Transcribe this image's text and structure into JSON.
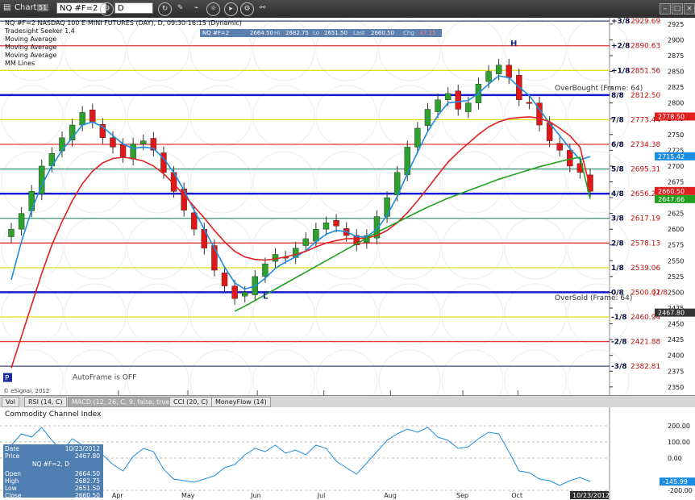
{
  "toolbar": {
    "title": "Chart",
    "badge": "51",
    "symbol": "NQ #F=2",
    "interval": "D"
  },
  "header": {
    "line1": "NQ #F=2 NASDAQ 100 E-MINI FUTURES (DAY), D, 09:30-16:15 (Dynamic)",
    "studies": [
      "Tradesight Seeker 1.4",
      "Moving Average",
      "Moving Average",
      "Moving Average",
      "MM Lines"
    ],
    "quote": {
      "symbol": "NQ #F=2",
      "open": "2664.50",
      "high_label": "Hi",
      "high": "2682.75",
      "low_label": "Lo",
      "low": "2651.50",
      "last_label": "Last",
      "last": "2660.50",
      "chg_label": "Chg",
      "chg": "-37.25"
    }
  },
  "chart_data": [
    {
      "type": "line",
      "title": "NQ #F=2 NASDAQ 100 E-MINI FUTURES (DAY), D, 09:30-16:15 (Dynamic)",
      "x_tick_labels": [
        "Apr",
        "May",
        "Jun",
        "Jul",
        "Aug",
        "Sep",
        "Oct"
      ],
      "y_ticks": [
        2350,
        2375,
        2400,
        2425,
        2450,
        2475,
        2500,
        2525,
        2550,
        2575,
        2600,
        2625,
        2650,
        2675,
        2700,
        2725,
        2750,
        2775,
        2800,
        2825,
        2850,
        2875,
        2900,
        2925
      ],
      "ylim": [
        2337,
        2935
      ],
      "price_series": {
        "name": "NQ #F=2",
        "close": [
          2600,
          2625,
          2660,
          2700,
          2720,
          2745,
          2765,
          2785,
          2770,
          2745,
          2730,
          2715,
          2735,
          2740,
          2725,
          2690,
          2660,
          2630,
          2600,
          2570,
          2535,
          2510,
          2490,
          2500,
          2525,
          2545,
          2560,
          2555,
          2570,
          2585,
          2600,
          2610,
          2605,
          2590,
          2575,
          2590,
          2620,
          2650,
          2690,
          2730,
          2760,
          2790,
          2805,
          2815,
          2790,
          2800,
          2830,
          2850,
          2860,
          2840,
          2805,
          2800,
          2765,
          2740,
          2725,
          2700,
          2690,
          2660
        ]
      },
      "moving_averages": [
        {
          "color": "#1c8ce0",
          "values": [
            2520,
            2580,
            2630,
            2670,
            2700,
            2725,
            2745,
            2765,
            2770,
            2762,
            2748,
            2735,
            2728,
            2730,
            2728,
            2712,
            2690,
            2662,
            2630,
            2600,
            2570,
            2540,
            2515,
            2505,
            2510,
            2522,
            2538,
            2548,
            2556,
            2566,
            2580,
            2592,
            2598,
            2596,
            2588,
            2588,
            2600,
            2622,
            2652,
            2688,
            2722,
            2755,
            2780,
            2800,
            2802,
            2804,
            2815,
            2830,
            2843,
            2840,
            2825,
            2812,
            2790,
            2768,
            2748,
            2728,
            2710,
            2715
          ]
        },
        {
          "color": "#e02020",
          "values": [
            2380,
            2430,
            2480,
            2530,
            2575,
            2612,
            2645,
            2672,
            2692,
            2705,
            2712,
            2714,
            2712,
            2708,
            2700,
            2688,
            2672,
            2654,
            2636,
            2618,
            2598,
            2580,
            2565,
            2556,
            2552,
            2551,
            2553,
            2556,
            2560,
            2565,
            2572,
            2578,
            2582,
            2585,
            2585,
            2586,
            2590,
            2598,
            2610,
            2626,
            2645,
            2665,
            2686,
            2706,
            2722,
            2736,
            2750,
            2762,
            2770,
            2775,
            2777,
            2778,
            2776,
            2770,
            2760,
            2748,
            2730,
            2665
          ]
        },
        {
          "color": "#22a022",
          "values": [
            null,
            null,
            null,
            null,
            null,
            null,
            null,
            null,
            null,
            null,
            null,
            null,
            null,
            null,
            null,
            null,
            null,
            null,
            null,
            null,
            null,
            null,
            2470,
            2478,
            2487,
            2496,
            2505,
            2514,
            2523,
            2532,
            2541,
            2550,
            2559,
            2568,
            2577,
            2586,
            2595,
            2603,
            2611,
            2619,
            2627,
            2635,
            2642,
            2649,
            2655,
            2661,
            2667,
            2673,
            2679,
            2684,
            2689,
            2694,
            2699,
            2703,
            2707,
            2711,
            2714,
            2648
          ]
        }
      ],
      "mm_lines": [
        {
          "label": "+3/8",
          "value": "2929.69",
          "color": "#223366"
        },
        {
          "label": "+2/8",
          "value": "2890.63",
          "color": "#e02020"
        },
        {
          "label": "+1/8",
          "value": "2851.56",
          "color": "#dddd00"
        },
        {
          "label": "8/8",
          "value": "2812.50",
          "color": "#0000cc"
        },
        {
          "label": "7/8",
          "value": "2773.44",
          "color": "#dddd00"
        },
        {
          "label": "6/8",
          "value": "2734.38",
          "color": "#e02020"
        },
        {
          "label": "5/8",
          "value": "2695.31",
          "color": "#2a8a6a"
        },
        {
          "label": "4/8",
          "value": "2656.25",
          "color": "#0000cc"
        },
        {
          "label": "3/8",
          "value": "2617.19",
          "color": "#2a8a6a"
        },
        {
          "label": "2/8",
          "value": "2578.13",
          "color": "#e02020"
        },
        {
          "label": "1/8",
          "value": "2539.06",
          "color": "#dddd00"
        },
        {
          "label": "0/8",
          "value": "2500.01",
          "color": "#0000cc"
        },
        {
          "label": "-1/8",
          "value": "2460.94",
          "color": "#dddd00"
        },
        {
          "label": "-2/8",
          "value": "2421.88",
          "color": "#e02020"
        },
        {
          "label": "-3/8",
          "value": "2382.81",
          "color": "#223366"
        }
      ],
      "price_tags": [
        {
          "value": "2778.50",
          "color": "#e02020"
        },
        {
          "value": "2715.42",
          "color": "#1c8ce0"
        },
        {
          "value": "2660.50",
          "color": "#e02020"
        },
        {
          "value": "2647.66",
          "color": "#22a022"
        },
        {
          "value": "2467.80",
          "color": "#333333"
        }
      ],
      "annotations": {
        "overbought": "OverBought (Frame: 64)",
        "oversold": "OverSold (Frame: 64)",
        "autoframe": "AutoFrame is OFF",
        "high_marker": "H",
        "low_marker": "L",
        "period_marker": "P",
        "footer": "© eSignal, 2012",
        "extra_tag": "[2/8"
      }
    },
    {
      "type": "line",
      "title": "Commodity Channel Index",
      "y_ticks": [
        -200,
        0,
        100,
        200
      ],
      "y_tick_labels": [
        "-200.00",
        "0.00",
        "100.00",
        "200.00"
      ],
      "ylim": [
        -245,
        245
      ],
      "series": [
        {
          "color": "#1c8ce0",
          "values": [
            80,
            150,
            130,
            190,
            110,
            40,
            120,
            80,
            60,
            20,
            -40,
            -80,
            10,
            60,
            40,
            -70,
            -130,
            -140,
            -150,
            -130,
            -110,
            -60,
            -40,
            20,
            60,
            40,
            80,
            30,
            50,
            20,
            80,
            60,
            -20,
            -60,
            -100,
            -30,
            40,
            110,
            150,
            180,
            160,
            190,
            130,
            110,
            60,
            70,
            120,
            160,
            150,
            40,
            -80,
            -90,
            -130,
            -140,
            -170,
            -140,
            -120,
            -145
          ]
        }
      ],
      "last_value": "-145.99",
      "date_tag": "10/23/2012"
    }
  ],
  "tabs": [
    "Vol",
    "RSI (14, C)",
    "MACD (12, 26, C, 9, false, true)",
    "CCI (20, C)",
    "MoneyFlow (14)"
  ],
  "active_tab": 3,
  "data_panel": {
    "date_label": "Date",
    "date": "10/23/2012",
    "price_label": "Price",
    "price": "2467.80",
    "symbol_line": "NQ #F=2, D",
    "open_label": "Open",
    "open": "2664.50",
    "high_label": "High",
    "high": "2682.75",
    "low_label": "Low",
    "low": "2651.50",
    "close_label": "Close",
    "close": "2660.50"
  },
  "colors": {
    "chart_bg": "#ffffff",
    "bull_candle": "#2ea02e",
    "bear_candle": "#e01818",
    "axis_bg": "#ffffff",
    "frame": "#2b2b2b"
  }
}
